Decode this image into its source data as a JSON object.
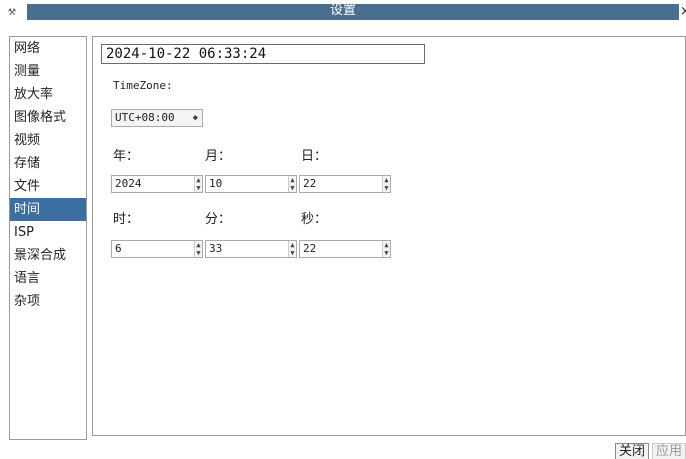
{
  "window": {
    "title": "设置",
    "close_glyph": "×",
    "app_icon": "tools-icon"
  },
  "sidebar": {
    "items": [
      {
        "label": "网络"
      },
      {
        "label": "测量"
      },
      {
        "label": "放大率"
      },
      {
        "label": "图像格式"
      },
      {
        "label": "视频"
      },
      {
        "label": "存储"
      },
      {
        "label": "文件"
      },
      {
        "label": "时间",
        "active": true
      },
      {
        "label": "ISP"
      },
      {
        "label": "景深合成"
      },
      {
        "label": "语言"
      },
      {
        "label": "杂项"
      }
    ]
  },
  "time": {
    "current_datetime": "2024-10-22 06:33:24",
    "timezone_label": "TimeZone:",
    "timezone_value": "UTC+08:00",
    "year_label": "年：",
    "month_label": "月：",
    "day_label": "日：",
    "year_value": "2024",
    "month_value": "10",
    "day_value": "22",
    "hour_label": "时：",
    "minute_label": "分：",
    "second_label": "秒：",
    "hour_value": "6",
    "minute_value": "33",
    "second_value": "22"
  },
  "footer": {
    "close_label": "关闭",
    "apply_label": "应用"
  },
  "colors": {
    "titlebar": "#4a6f8e",
    "selected": "#3d6fa3"
  }
}
